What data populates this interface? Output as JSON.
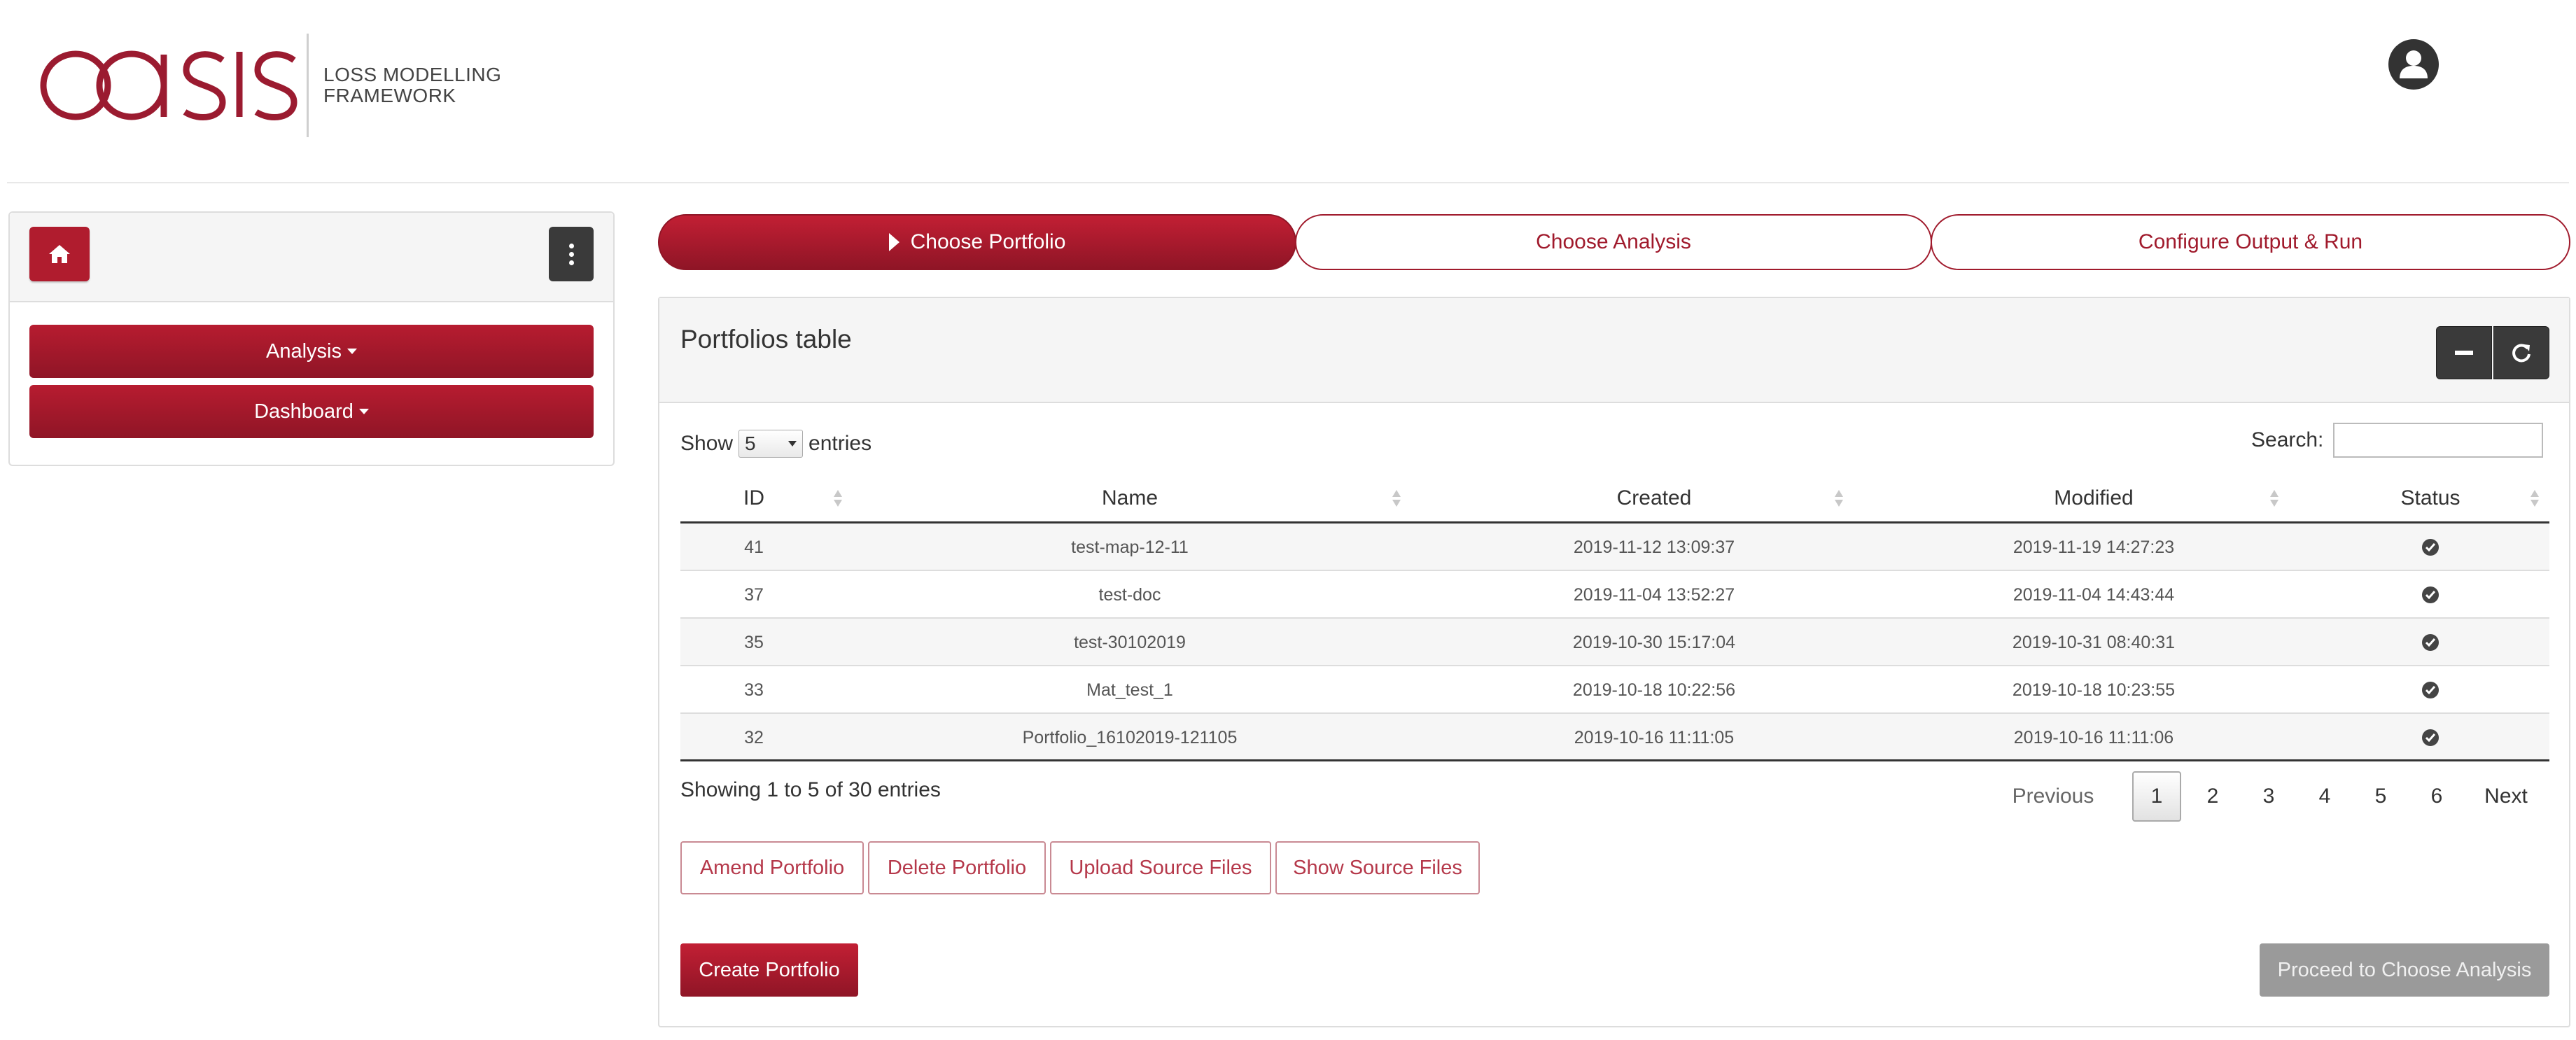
{
  "header": {
    "brand": "oasis",
    "tagline_line1": "LOSS MODELLING",
    "tagline_line2": "FRAMEWORK",
    "user_icon": "user-circle-icon"
  },
  "sidebar": {
    "home_icon": "home-icon",
    "menu_icon": "ellipsis-vertical-icon",
    "items": [
      {
        "label": "Analysis"
      },
      {
        "label": "Dashboard"
      }
    ]
  },
  "steps": [
    {
      "label": "Choose Portfolio",
      "active": true
    },
    {
      "label": "Choose Analysis",
      "active": false
    },
    {
      "label": "Configure Output & Run",
      "active": false
    }
  ],
  "panel": {
    "title": "Portfolios table",
    "collapse_icon": "minus-icon",
    "refresh_icon": "refresh-icon"
  },
  "table": {
    "show_label": "Show",
    "entries_value": "5",
    "entries_label": "entries",
    "search_label": "Search:",
    "search_value": "",
    "columns": [
      "ID",
      "Name",
      "Created",
      "Modified",
      "Status"
    ],
    "rows": [
      {
        "id": "41",
        "name": "test-map-12-11",
        "created": "2019-11-12 13:09:37",
        "modified": "2019-11-19 14:27:23",
        "status": "check-circle-icon"
      },
      {
        "id": "37",
        "name": "test-doc",
        "created": "2019-11-04 13:52:27",
        "modified": "2019-11-04 14:43:44",
        "status": "check-circle-icon"
      },
      {
        "id": "35",
        "name": "test-30102019",
        "created": "2019-10-30 15:17:04",
        "modified": "2019-10-31 08:40:31",
        "status": "check-circle-icon"
      },
      {
        "id": "33",
        "name": "Mat_test_1",
        "created": "2019-10-18 10:22:56",
        "modified": "2019-10-18 10:23:55",
        "status": "check-circle-icon"
      },
      {
        "id": "32",
        "name": "Portfolio_16102019-121105",
        "created": "2019-10-16 11:11:05",
        "modified": "2019-10-16 11:11:06",
        "status": "check-circle-icon"
      }
    ],
    "info": "Showing 1 to 5 of 30 entries",
    "pagination": {
      "previous": "Previous",
      "pages": [
        "1",
        "2",
        "3",
        "4",
        "5",
        "6"
      ],
      "current": "1",
      "next": "Next"
    }
  },
  "actions": {
    "amend": "Amend Portfolio",
    "delete": "Delete Portfolio",
    "upload": "Upload Source Files",
    "show": "Show Source Files",
    "create": "Create Portfolio",
    "proceed": "Proceed to Choose Analysis"
  },
  "colors": {
    "brand_red": "#a01a2c",
    "dark_button": "#3a3a3a",
    "disabled_button": "#9a9a9a"
  }
}
